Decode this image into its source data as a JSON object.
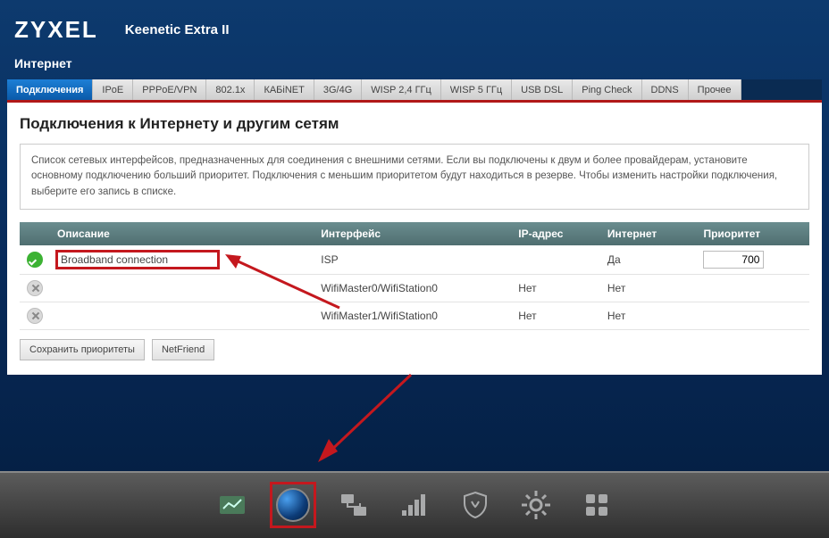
{
  "header": {
    "logo": "ZYXEL",
    "model": "Keenetic Extra II"
  },
  "section": "Интернет",
  "tabs": [
    "Подключения",
    "IPoE",
    "PPPoE/VPN",
    "802.1x",
    "КАБiNET",
    "3G/4G",
    "WISP 2,4 ГГц",
    "WISP 5 ГГц",
    "USB DSL",
    "Ping Check",
    "DDNS",
    "Прочее"
  ],
  "active_tab": 0,
  "panel": {
    "title": "Подключения к Интернету и другим сетям",
    "info": "Список сетевых интерфейсов, предназначенных для соединения с внешними сетями. Если вы подключены к двум и более провайдерам, установите основному подключению больший приоритет. Подключения с меньшим приоритетом будут находиться в резерве. Чтобы изменить настройки подключения, выберите его запись в списке.",
    "columns": [
      "Описание",
      "Интерфейс",
      "IP-адрес",
      "Интернет",
      "Приоритет"
    ],
    "rows": [
      {
        "status": "ok",
        "desc": "Broadband connection",
        "iface": "ISP",
        "ip": "",
        "inet": "Да",
        "prio": "700",
        "hl": true
      },
      {
        "status": "off",
        "desc": "",
        "iface": "WifiMaster0/WifiStation0",
        "ip": "Нет",
        "inet": "Нет",
        "prio": "",
        "hl": false
      },
      {
        "status": "off",
        "desc": "",
        "iface": "WifiMaster1/WifiStation0",
        "ip": "Нет",
        "inet": "Нет",
        "prio": "",
        "hl": false
      }
    ],
    "buttons": {
      "save": "Сохранить приоритеты",
      "netfriend": "NetFriend"
    }
  },
  "bottom_icons": [
    "dashboard",
    "globe",
    "network",
    "signal",
    "shield",
    "gear",
    "apps"
  ],
  "bottom_selected": 1
}
